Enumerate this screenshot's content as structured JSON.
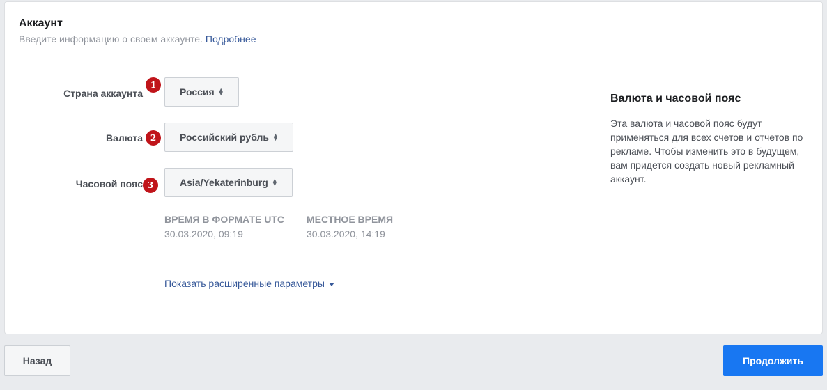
{
  "card": {
    "title": "Аккаунт",
    "subtitle": "Введите информацию о своем аккаунте.",
    "subtitle_link": "Подробнее"
  },
  "fields": {
    "country": {
      "label": "Страна аккаунта",
      "badge": "1",
      "value": "Россия"
    },
    "currency": {
      "label": "Валюта",
      "badge": "2",
      "value": "Российский рубль"
    },
    "timezone": {
      "label": "Часовой пояс",
      "badge": "3",
      "value": "Asia/Yekaterinburg"
    }
  },
  "time": {
    "utc_label": "ВРЕМЯ В ФОРМАТЕ UTC",
    "utc_value": "30.03.2020, 09:19",
    "local_label": "МЕСТНОЕ ВРЕМЯ",
    "local_value": "30.03.2020, 14:19"
  },
  "advanced_link": "Показать расширенные параметры",
  "side": {
    "title": "Валюта и часовой пояс",
    "text": "Эта валюта и часовой пояс будут применяться для всех счетов и отчетов по рекламе. Чтобы изменить это в будущем, вам придется создать новый рекламный аккаунт."
  },
  "footer": {
    "back": "Назад",
    "continue": "Продолжить"
  },
  "colors": {
    "primary": "#1877f2",
    "link": "#365899",
    "badge": "#c0141a"
  }
}
